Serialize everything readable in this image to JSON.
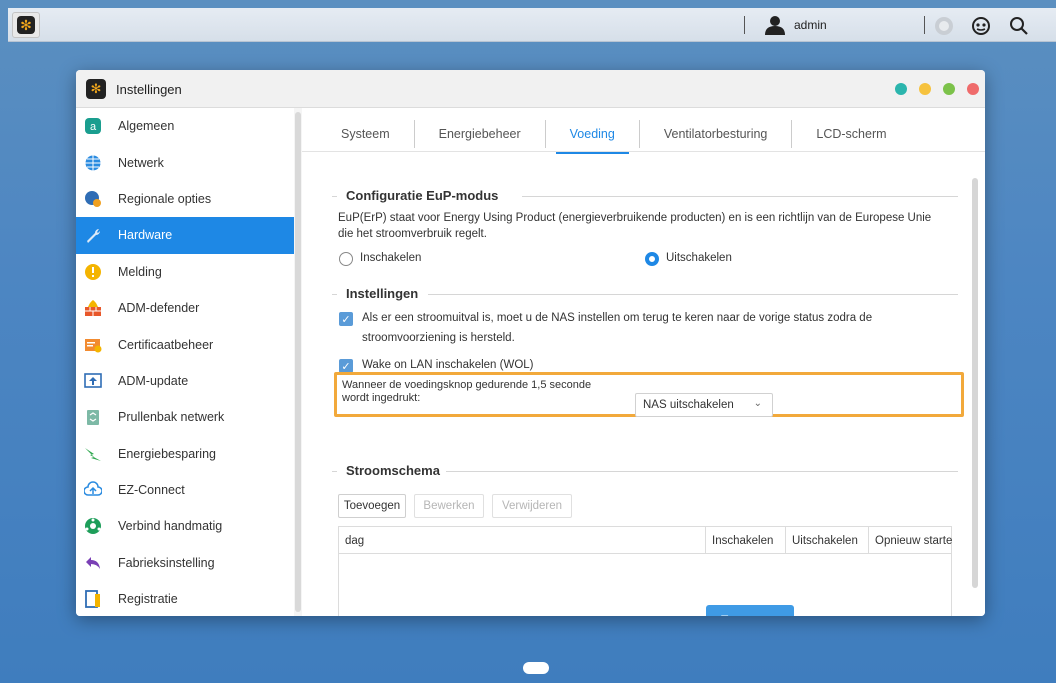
{
  "topbar": {
    "user_name": "admin"
  },
  "window": {
    "title": "Instellingen",
    "dots": [
      "#2bb5ad",
      "#f6c23e",
      "#7cc24a",
      "#ef6b6b"
    ]
  },
  "sidebar": {
    "active_color": "#1e88e5",
    "items": [
      {
        "label": "Algemeen",
        "icon": "general-icon"
      },
      {
        "label": "Netwerk",
        "icon": "globe-icon"
      },
      {
        "label": "Regionale opties",
        "icon": "region-icon"
      },
      {
        "label": "Hardware",
        "icon": "wrench-icon",
        "active": true
      },
      {
        "label": "Melding",
        "icon": "alert-icon"
      },
      {
        "label": "ADM-defender",
        "icon": "firewall-icon"
      },
      {
        "label": "Certificaatbeheer",
        "icon": "certificate-icon"
      },
      {
        "label": "ADM-update",
        "icon": "update-icon"
      },
      {
        "label": "Prullenbak netwerk",
        "icon": "recycle-bin-icon"
      },
      {
        "label": "Energiebesparing",
        "icon": "energy-icon"
      },
      {
        "label": "EZ-Connect",
        "icon": "cloud-icon"
      },
      {
        "label": "Verbind handmatig",
        "icon": "connect-icon"
      },
      {
        "label": "Fabrieksinstelling",
        "icon": "reset-icon"
      },
      {
        "label": "Registratie",
        "icon": "registration-icon"
      }
    ]
  },
  "tabs": [
    {
      "label": "Systeem"
    },
    {
      "label": "Energiebeheer"
    },
    {
      "label": "Voeding",
      "active": true
    },
    {
      "label": "Ventilatorbesturing"
    },
    {
      "label": "LCD-scherm"
    }
  ],
  "eup": {
    "title": "Configuratie EuP-modus",
    "description_1": "EuP(ErP) staat voor Energy Using Product (energieverbruikende producten) en is een richtlijn van de Europese Unie",
    "description_2": "die het stroomverbruik regelt.",
    "option_enable": "Inschakelen",
    "option_disable": "Uitschakelen",
    "selected": "Uitschakelen"
  },
  "settings": {
    "title": "Instellingen",
    "power_restore_1": "Als er een stroomuitval is, moet u de NAS instellen om terug te keren naar de vorige status zodra de",
    "power_restore_2": "stroomvoorziening is hersteld.",
    "power_restore_checked": true,
    "wol_label": "Wake on LAN inschakelen (WOL)",
    "wol_checked": true,
    "power_button_label_1": "Wanneer de voedingsknop gedurende 1,5 seconde",
    "power_button_label_2": "wordt ingedrukt:",
    "power_button_value": "NAS uitschakelen"
  },
  "schedule": {
    "title": "Stroomschema",
    "add_label": "Toevoegen",
    "edit_label": "Bewerken",
    "delete_label": "Verwijderen",
    "columns": [
      "dag",
      "Inschakelen",
      "Uitschakelen",
      "Opnieuw starte"
    ]
  },
  "apply_label": "Toepassen"
}
